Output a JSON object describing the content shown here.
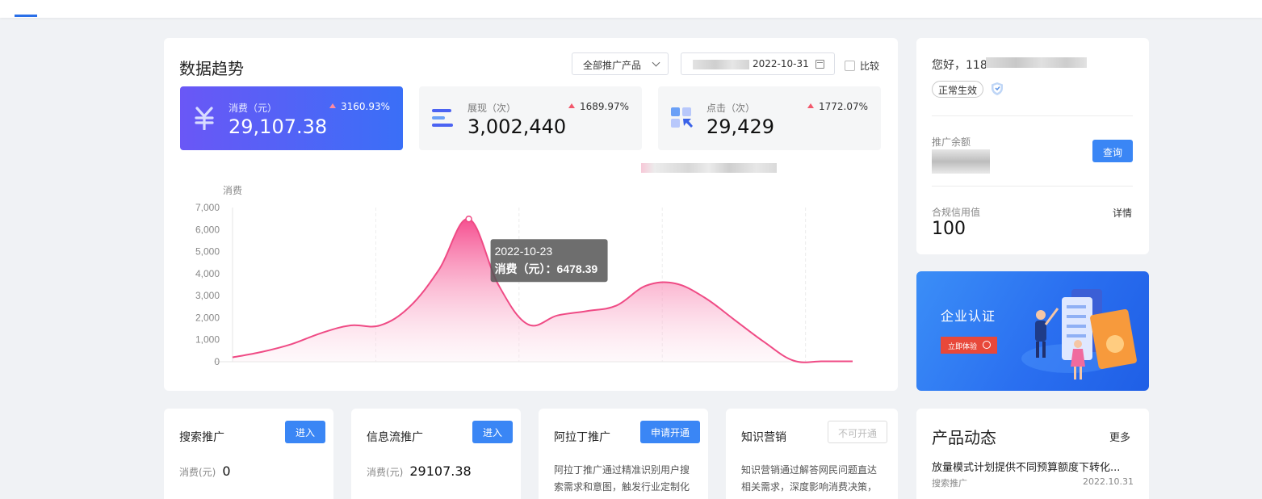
{
  "trend": {
    "title": "数据趋势",
    "product_select": "全部推广产品",
    "date_end": "2022-10-31",
    "compare_label": "比较",
    "metrics": [
      {
        "label": "消费（元）",
        "value": "29,107.38",
        "pct": "3160.93%"
      },
      {
        "label": "展现（次）",
        "value": "3,002,440",
        "pct": "1689.97%"
      },
      {
        "label": "点击（次）",
        "value": "29,429",
        "pct": "1772.07%"
      }
    ]
  },
  "chart_data": {
    "type": "area",
    "ylabel": "消费",
    "ylim": [
      0,
      7000
    ],
    "yticks": [
      "7,000",
      "6,000",
      "5,000",
      "4,000",
      "3,000",
      "2,000",
      "1,000",
      "0"
    ],
    "grid": "vertical-dashed",
    "series": [
      {
        "values": [
          200,
          450,
          800,
          1300,
          1650,
          1650,
          2500,
          4200,
          6478.39,
          3500,
          1700,
          2100,
          2300,
          2550,
          3450,
          3550,
          2900,
          1900,
          900,
          50,
          20,
          20
        ]
      }
    ],
    "color": "#f0508c",
    "tooltip": {
      "date": "2022-10-23",
      "text": "消费（元）：6478.39"
    }
  },
  "profile": {
    "greeting": "您好，118",
    "status": "正常生效",
    "balance_label": "推广余额",
    "query_btn": "查询",
    "credit_label": "合规信用值",
    "credit_value": "100",
    "detail_link": "详情"
  },
  "banner": {
    "title": "企业认证",
    "button": "立即体验"
  },
  "products": [
    {
      "title": "搜索推广",
      "button": "进入",
      "spend_label": "消费(元)",
      "spend_value": "0"
    },
    {
      "title": "信息流推广",
      "button": "进入",
      "spend_label": "消费(元)",
      "spend_value": "29107.38"
    },
    {
      "title": "阿拉丁推广",
      "button": "申请开通",
      "desc": "阿拉丁推广通过精准识别用户搜索需求和意图，触发行业定制化"
    },
    {
      "title": "知识营销",
      "button": "不可开通",
      "desc": "知识营销通过解答网民问题直达相关需求，深度影响消费决策，"
    }
  ],
  "news": {
    "title": "产品动态",
    "more": "更多",
    "item": "放量模式计划提供不同预算额度下转化...",
    "category": "搜索推广",
    "date": "2022.10.31"
  },
  "colors": {
    "accent": "#3a86f5",
    "metric_active_start": "#6a57f6",
    "metric_active_end": "#3a6ff7",
    "up_arrow": "#f2586c"
  }
}
